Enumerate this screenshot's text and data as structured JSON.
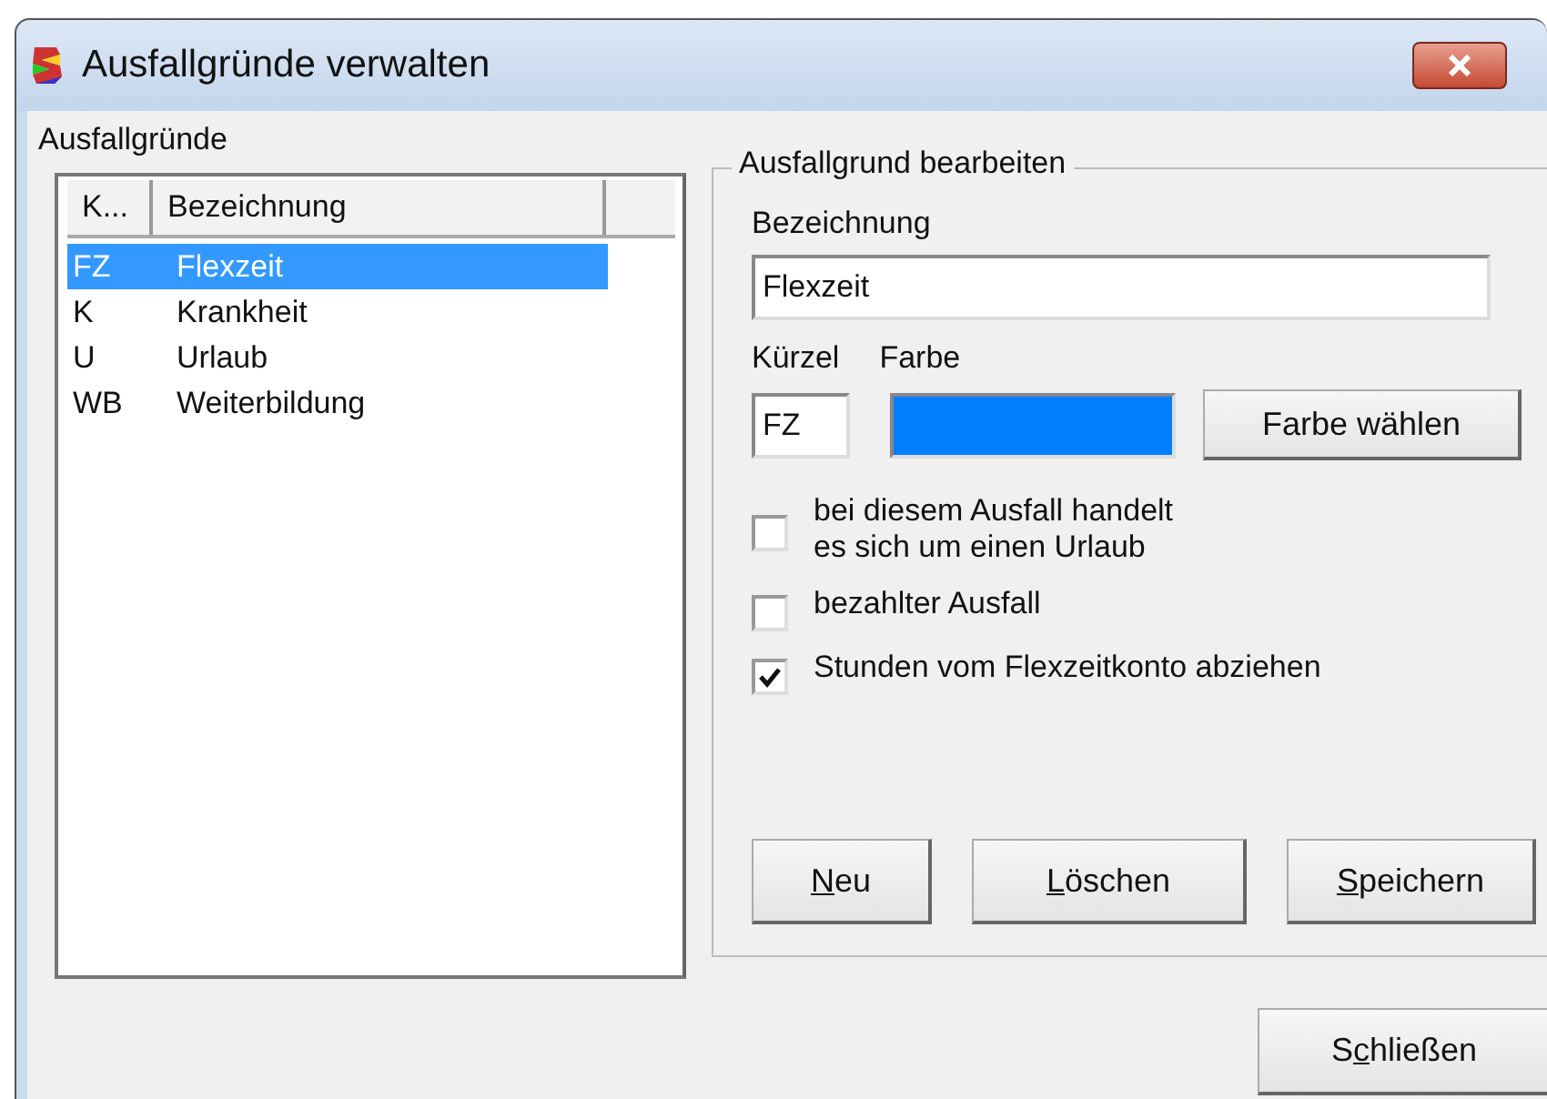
{
  "window": {
    "title": "Ausfallgründe verwalten"
  },
  "list": {
    "label": "Ausfallgründe",
    "columns": [
      "K...",
      "Bezeichnung"
    ],
    "rows": [
      {
        "code": "FZ",
        "name": "Flexzeit",
        "selected": true
      },
      {
        "code": "K",
        "name": "Krankheit",
        "selected": false
      },
      {
        "code": "U",
        "name": "Urlaub",
        "selected": false
      },
      {
        "code": "WB",
        "name": "Weiterbildung",
        "selected": false
      }
    ]
  },
  "editor": {
    "title": "Ausfallgrund bearbeiten",
    "name_label": "Bezeichnung",
    "name_value": "Flexzeit",
    "code_label": "Kürzel",
    "code_value": "FZ",
    "color_label": "Farbe",
    "color": "#0080ff",
    "color_button": "Farbe wählen",
    "checkboxes": [
      {
        "label": "bei diesem Ausfall handelt\nes sich um einen Urlaub",
        "checked": false
      },
      {
        "label": "bezahlter Ausfall",
        "checked": false
      },
      {
        "label": "Stunden vom Flexzeitkonto abziehen",
        "checked": true
      }
    ],
    "buttons": [
      {
        "label": [
          {
            "text": "N",
            "underlined": true
          },
          {
            "text": "eu",
            "underlined": false
          }
        ]
      },
      {
        "label": [
          {
            "text": "L",
            "underlined": true
          },
          {
            "text": "öschen",
            "underlined": false
          }
        ]
      },
      {
        "label": [
          {
            "text": "S",
            "underlined": true
          },
          {
            "text": "peichern",
            "underlined": false
          }
        ]
      }
    ]
  },
  "close_button": {
    "label": [
      {
        "text": "S",
        "underlined": false
      },
      {
        "text": "c",
        "underlined": true
      },
      {
        "text": "hließen",
        "underlined": false
      }
    ]
  }
}
